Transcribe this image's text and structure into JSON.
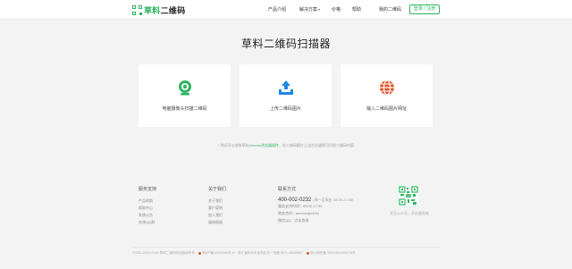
{
  "header": {
    "logo_text_main": "草料",
    "logo_text_rest": "二维码",
    "nav": [
      {
        "label": "产品介绍"
      },
      {
        "label": "解决方案"
      },
      {
        "label": "价格"
      },
      {
        "label": "帮助"
      },
      {
        "label": "我的二维码"
      }
    ],
    "login_label": "登录 / 注册"
  },
  "main": {
    "title": "草料二维码扫描器",
    "cards": [
      {
        "label": "电脑摄像头扫描二维码",
        "icon": "webcam-icon"
      },
      {
        "label": "上传二维码图片",
        "icon": "upload-icon"
      },
      {
        "label": "输入二维码图片网址",
        "icon": "globe-icon"
      }
    ],
    "tip_prefix": "* 你还可以安装草料",
    "tip_link": "chrome浏览器插件",
    "tip_suffix": "，在二维码图片上点击右键即可识别二维码内容"
  },
  "footer": {
    "col1": {
      "title": "服务支持",
      "items": [
        "产品帮助",
        "帮助中心",
        "系统公告",
        "在线QQ群"
      ]
    },
    "col2": {
      "title": "关于我们",
      "items": [
        "关于我们",
        "客户案例",
        "加入我们",
        "媒体报道"
      ]
    },
    "col3": {
      "title": "联系方式",
      "phone": "400-002-0232",
      "phone_hours": "(周一至周五 09:00-21:00)",
      "items": [
        "服务支持时间：09:00-17:30",
        "商务合作：service@cli.im",
        "微信QQ：点击咨询"
      ]
    },
    "qr_caption": "关注公众号，开启服务推",
    "copyright": "©2011-2024 Cli.im 草料二维码网站版权所有",
    "icp": "浙ICP备12005589号-6",
    "address": "浙江省杭州市余杭区文一西路  0571-56345857",
    "police": "浙公网安备 33010602000276号"
  },
  "colors": {
    "brand": "#2fb462",
    "accent": "#d65a2b"
  }
}
